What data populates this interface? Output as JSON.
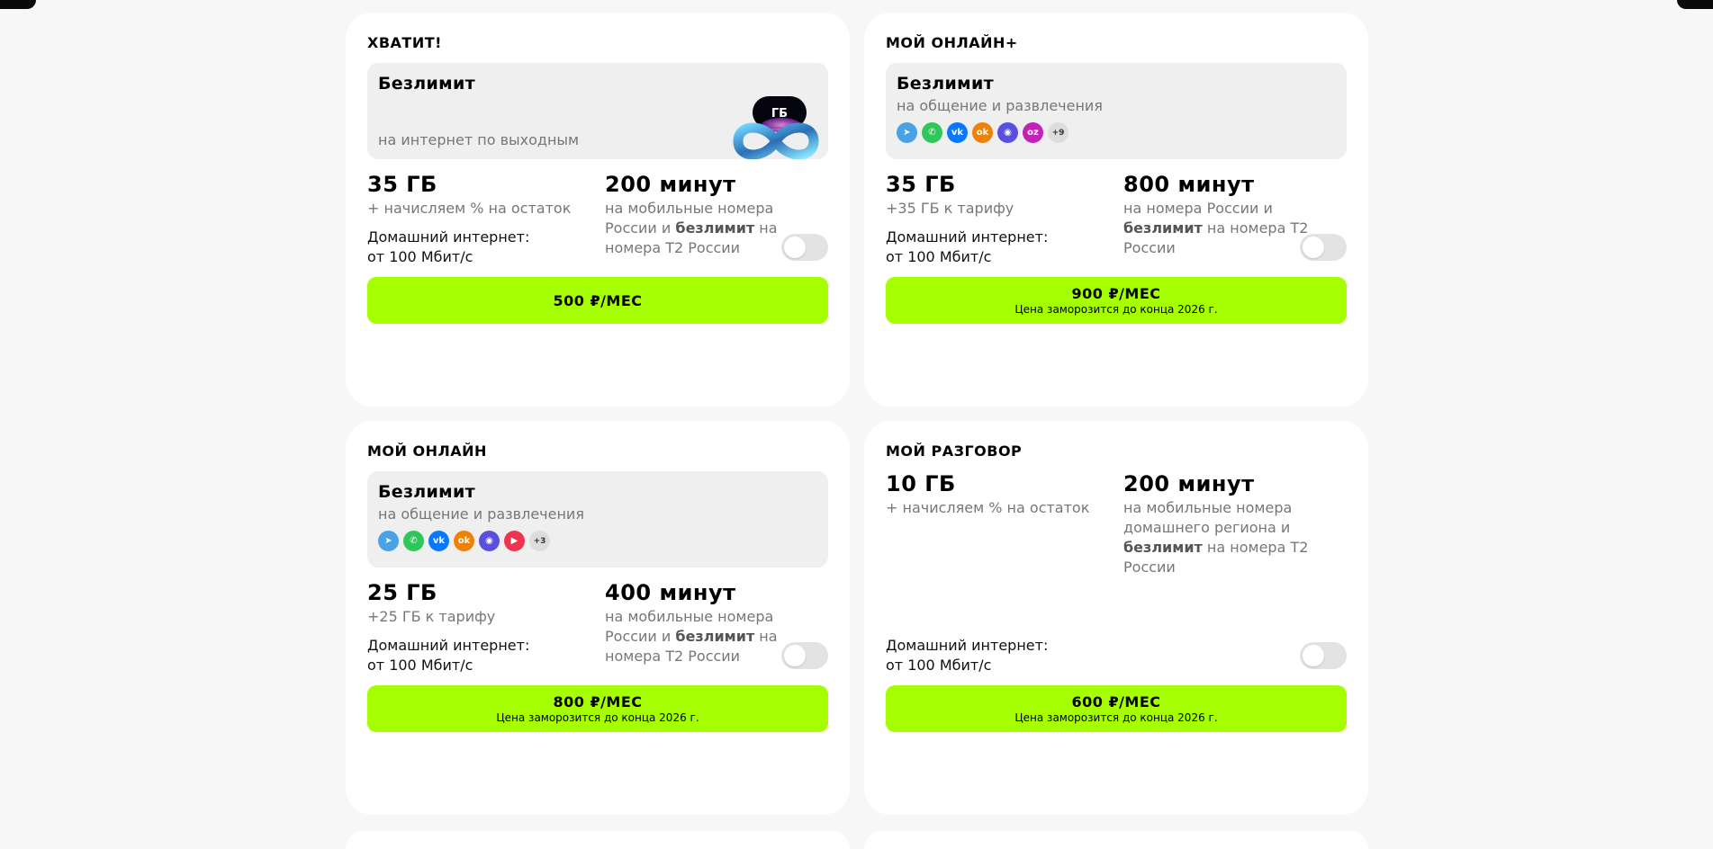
{
  "cards": [
    {
      "title": "ХВАТИТ!",
      "promo": {
        "heading": "Безлимит",
        "subtitle": "на интернет по выходным",
        "art_label": "ГБ"
      },
      "stat1": {
        "value": "35 ГБ",
        "desc": "+ начисляем % на остаток"
      },
      "stat2": {
        "value": "200 минут",
        "desc_pre": "на мобильные номера России и ",
        "desc_bold": "безлимит",
        "desc_post": " на номера Т2 России"
      },
      "home_line1": "Домашний интернет:",
      "home_line2": "от 100 Мбит/с",
      "price": "500 ₽/МЕС",
      "price_note": ""
    },
    {
      "title": "МОЙ ОНЛАЙН+",
      "promo": {
        "heading": "Безлимит",
        "subtitle": "на общение и развлечения",
        "more": "+9",
        "icons": [
          {
            "name": "telegram-icon",
            "color": "#4aa2e6",
            "glyph": "➤"
          },
          {
            "name": "whatsapp-icon",
            "color": "#2fc65a",
            "glyph": "✆"
          },
          {
            "name": "vk-icon",
            "color": "#0a77ff",
            "glyph": "vk"
          },
          {
            "name": "ok-icon",
            "color": "#ee8208",
            "glyph": "ok"
          },
          {
            "name": "max-icon",
            "color": "#5b4fe0",
            "glyph": "◉"
          },
          {
            "name": "ozon-icon",
            "color": "#c322b8",
            "glyph": "oz"
          }
        ]
      },
      "stat1": {
        "value": "35 ГБ",
        "desc": "+35 ГБ к тарифу"
      },
      "stat2": {
        "value": "800 минут",
        "desc_pre": "на номера России и ",
        "desc_bold": "безлимит",
        "desc_post": " на номера Т2 России"
      },
      "home_line1": "Домашний интернет:",
      "home_line2": "от 100 Мбит/с",
      "price": "900 ₽/МЕС",
      "price_note": "Цена заморозится до конца 2026 г."
    },
    {
      "title": "МОЙ ОНЛАЙН",
      "promo": {
        "heading": "Безлимит",
        "subtitle": "на общение и развлечения",
        "more": "+3",
        "icons": [
          {
            "name": "telegram-icon",
            "color": "#4aa2e6",
            "glyph": "➤"
          },
          {
            "name": "whatsapp-icon",
            "color": "#2fc65a",
            "glyph": "✆"
          },
          {
            "name": "vk-icon",
            "color": "#0a77ff",
            "glyph": "vk"
          },
          {
            "name": "ok-icon",
            "color": "#ee8208",
            "glyph": "ok"
          },
          {
            "name": "max-icon",
            "color": "#5b4fe0",
            "glyph": "◉"
          },
          {
            "name": "play-icon",
            "color": "#ee3450",
            "glyph": "▶"
          }
        ]
      },
      "stat1": {
        "value": "25 ГБ",
        "desc": "+25 ГБ к тарифу"
      },
      "stat2": {
        "value": "400 минут",
        "desc_pre": "на мобильные номера России и ",
        "desc_bold": "безлимит",
        "desc_post": " на номера Т2 России"
      },
      "home_line1": "Домашний интернет:",
      "home_line2": "от 100 Мбит/с",
      "price": "800 ₽/МЕС",
      "price_note": "Цена заморозится до конца 2026 г."
    },
    {
      "title": "МОЙ РАЗГОВОР",
      "stat1": {
        "value": "10 ГБ",
        "desc": "+ начисляем % на остаток"
      },
      "stat2": {
        "value": "200 минут",
        "desc_pre": "на мобильные номера домашнего региона и ",
        "desc_bold": "безлимит",
        "desc_post": " на номера Т2 России"
      },
      "home_line1": "Домашний интернет:",
      "home_line2": "от 100 Мбит/с",
      "price": "600 ₽/МЕС",
      "price_note": "Цена заморозится до конца 2026 г."
    }
  ],
  "colors": {
    "accent": "#a6ff00",
    "promo_bg": "#efefef",
    "muted_text": "#777777"
  }
}
